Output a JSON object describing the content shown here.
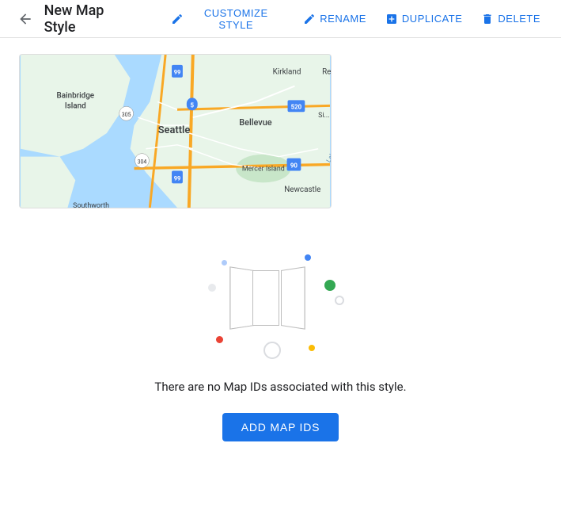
{
  "header": {
    "back_label": "←",
    "title": "New Map Style",
    "actions": [
      {
        "id": "customize",
        "label": "CUSTOMIZE STYLE",
        "icon": "pencil"
      },
      {
        "id": "rename",
        "label": "RENAME",
        "icon": "pencil"
      },
      {
        "id": "duplicate",
        "label": "DUPLICATE",
        "icon": "plus-square"
      },
      {
        "id": "delete",
        "label": "DELETE",
        "icon": "trash"
      }
    ]
  },
  "empty_state": {
    "message": "There are no Map IDs associated with this style.",
    "add_button_label": "ADD MAP IDS"
  },
  "colors": {
    "primary_blue": "#1a73e8",
    "dot_blue": "#4285F4",
    "dot_green": "#34A853",
    "dot_red": "#EA4335",
    "dot_yellow": "#FBBC05",
    "dot_light_blue": "#aecbfa",
    "dot_light_gray": "#dadce0"
  }
}
